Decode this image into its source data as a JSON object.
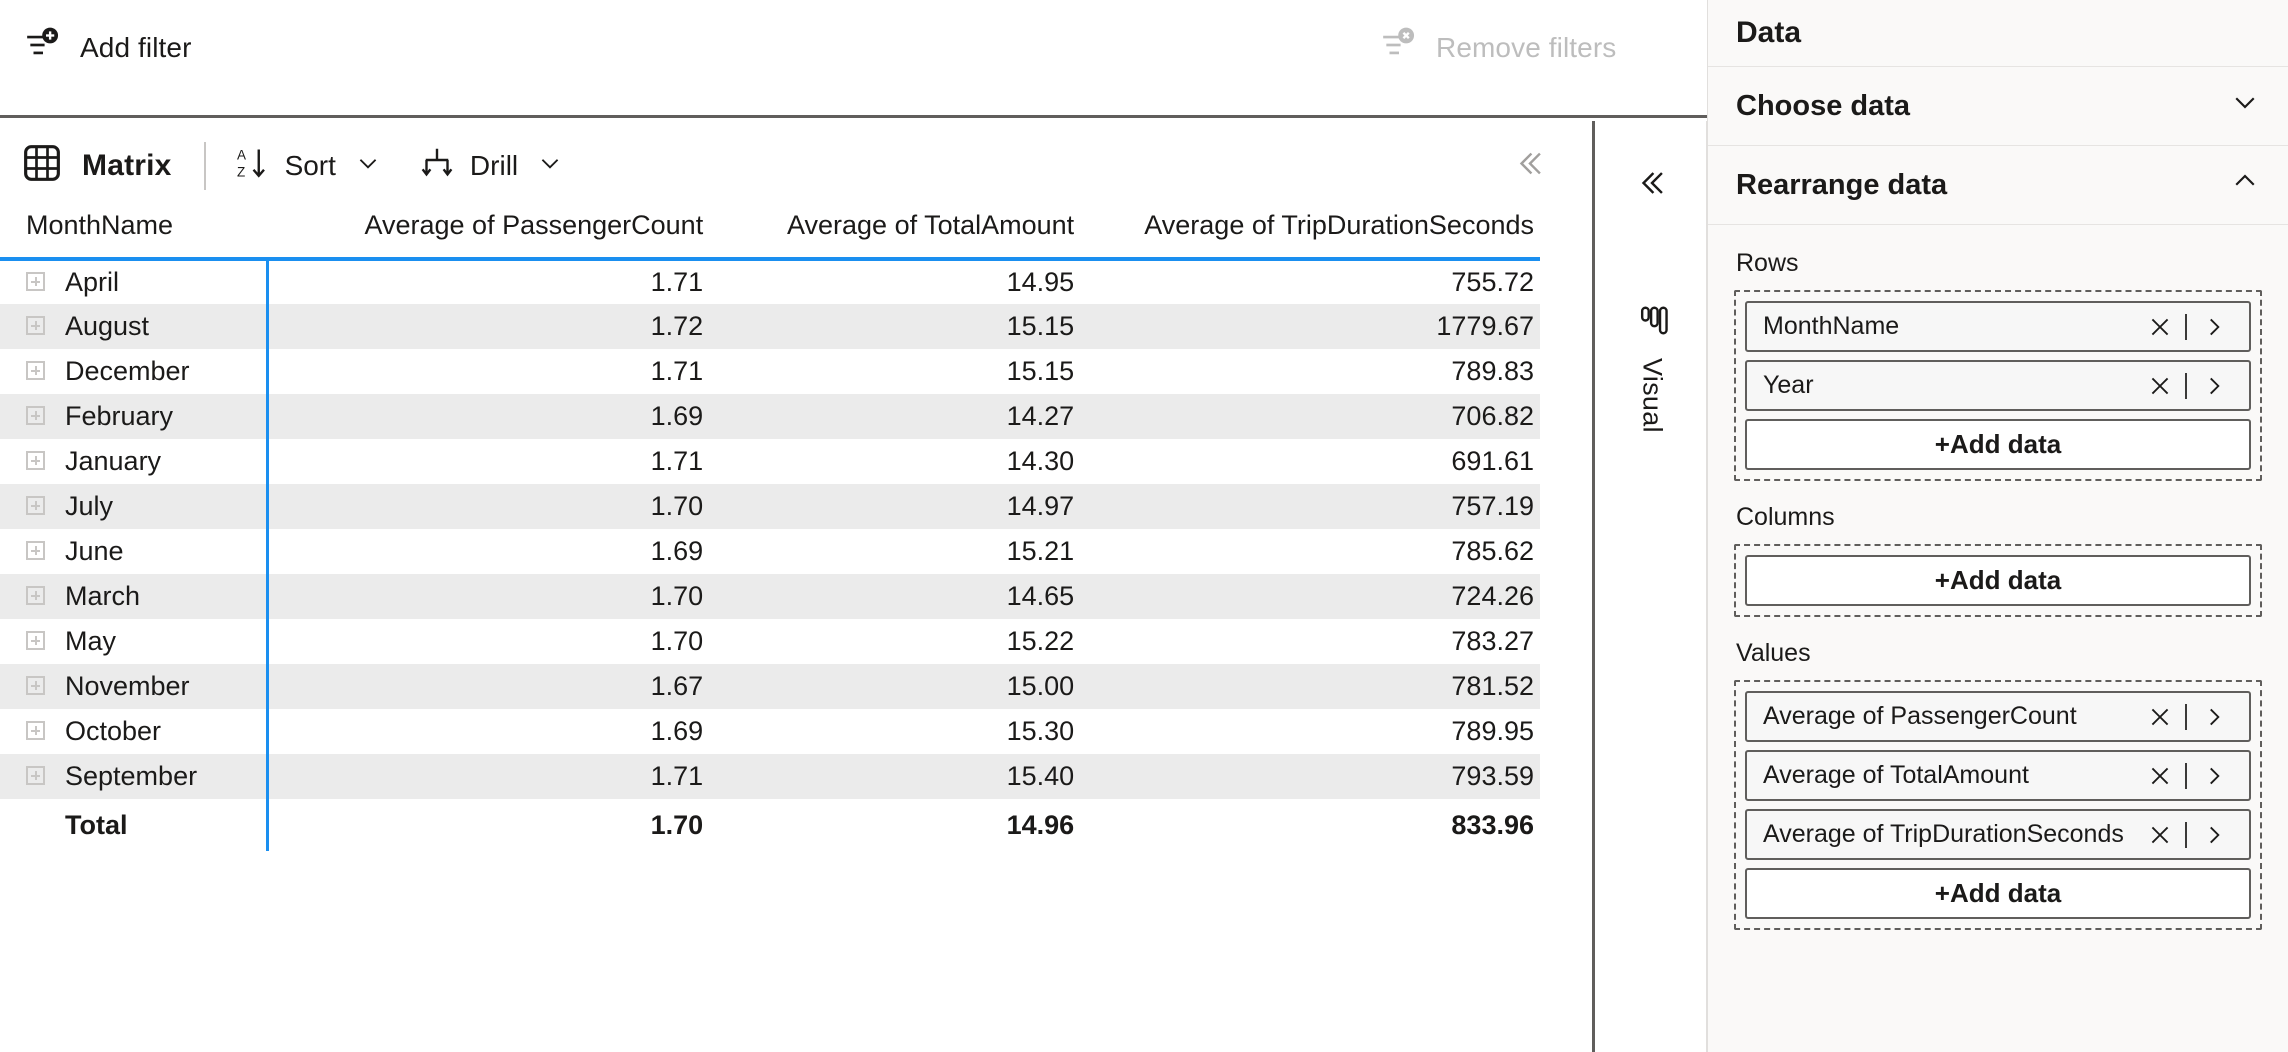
{
  "filter_bar": {
    "add_filter_label": "Add filter",
    "add_filter_icon": "filter-add-icon",
    "remove_filters_label": "Remove filters",
    "remove_filters_icon": "filter-remove-icon",
    "remove_filters_disabled": true
  },
  "matrix": {
    "icon": "grid-icon",
    "title": "Matrix",
    "sort_label": "Sort",
    "sort_icon": "sort-az-icon",
    "drill_label": "Drill",
    "drill_icon": "drill-icon",
    "caret_icon": "chevron-down-icon",
    "collapse_icon": "double-chevron-left-icon",
    "accent_color": "#1a8ff0",
    "alt_row_color": "#ebebeb"
  },
  "table": {
    "columns": [
      "MonthName",
      "Average of PassengerCount",
      "Average of TotalAmount",
      "Average of TripDurationSeconds"
    ],
    "rows": [
      {
        "month": "April",
        "passenger": "1.71",
        "total": "14.95",
        "duration": "755.72"
      },
      {
        "month": "August",
        "passenger": "1.72",
        "total": "15.15",
        "duration": "1779.67"
      },
      {
        "month": "December",
        "passenger": "1.71",
        "total": "15.15",
        "duration": "789.83"
      },
      {
        "month": "February",
        "passenger": "1.69",
        "total": "14.27",
        "duration": "706.82"
      },
      {
        "month": "January",
        "passenger": "1.71",
        "total": "14.30",
        "duration": "691.61"
      },
      {
        "month": "July",
        "passenger": "1.70",
        "total": "14.97",
        "duration": "757.19"
      },
      {
        "month": "June",
        "passenger": "1.69",
        "total": "15.21",
        "duration": "785.62"
      },
      {
        "month": "March",
        "passenger": "1.70",
        "total": "14.65",
        "duration": "724.26"
      },
      {
        "month": "May",
        "passenger": "1.70",
        "total": "15.22",
        "duration": "783.27"
      },
      {
        "month": "November",
        "passenger": "1.67",
        "total": "15.00",
        "duration": "781.52"
      },
      {
        "month": "October",
        "passenger": "1.69",
        "total": "15.30",
        "duration": "789.95"
      },
      {
        "month": "September",
        "passenger": "1.71",
        "total": "15.40",
        "duration": "793.59"
      }
    ],
    "total_row": {
      "label": "Total",
      "passenger": "1.70",
      "total": "14.96",
      "duration": "833.96"
    },
    "expand_icon": "expand-plus-icon"
  },
  "visual_rail": {
    "collapse_icon": "double-chevron-left-icon",
    "tab_icon": "bar-chart-icon",
    "tab_label": "Visual"
  },
  "data_panel": {
    "title": "Data",
    "sections": [
      {
        "title": "Choose data",
        "expanded": false,
        "chevron": "chevron-down-icon"
      },
      {
        "title": "Rearrange data",
        "expanded": true,
        "chevron": "chevron-up-icon"
      }
    ],
    "buckets": [
      {
        "label": "Rows",
        "chips": [
          "MonthName",
          "Year"
        ],
        "add_label": "+Add data"
      },
      {
        "label": "Columns",
        "chips": [],
        "add_label": "+Add data"
      },
      {
        "label": "Values",
        "chips": [
          "Average of PassengerCount",
          "Average of TotalAmount",
          "Average of TripDurationSeconds"
        ],
        "add_label": "+Add data"
      }
    ],
    "chip_remove_icon": "close-icon",
    "chip_expand_icon": "chevron-right-icon"
  }
}
